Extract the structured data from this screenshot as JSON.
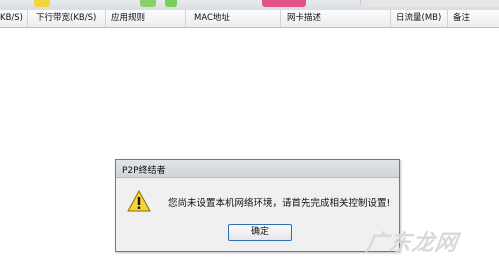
{
  "columns": {
    "col1": "KB/S)",
    "col2": "下行带宽(KB/S)",
    "col3": "应用规则",
    "col4": "MAC地址",
    "col5": "网卡描述",
    "col6": "日流量(MB)",
    "col7": "备注"
  },
  "dialog": {
    "title": "P2P终结者",
    "message": "您尚未设置本机网络环境，请首先完成相关控制设置!",
    "ok_label": "确定",
    "icon": "warning-icon"
  },
  "watermark": "广东龙网",
  "colors": {
    "dialog_border": "#6f7a86",
    "button_border": "#2f6fb5",
    "warning_fill": "#f5d43a"
  }
}
